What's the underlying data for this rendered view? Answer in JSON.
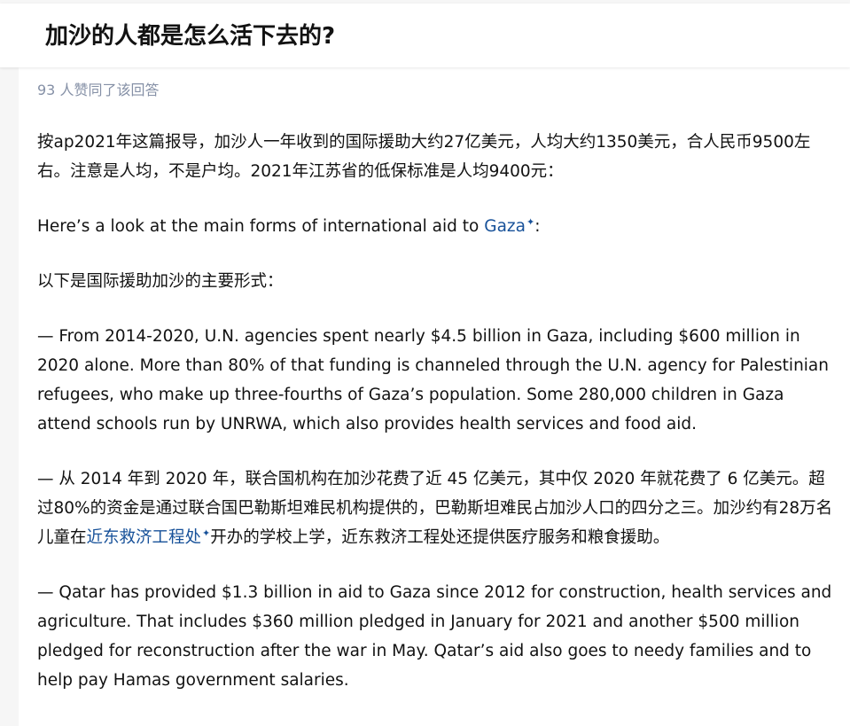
{
  "question": {
    "title": "加沙的人都是怎么活下去的?"
  },
  "answer": {
    "votes_label": "93 人赞同了该回答",
    "paragraphs": {
      "p1": "按ap2021年这篇报导，加沙人一年收到的国际援助大约27亿美元，人均大约1350美元，合人民币9500左右。注意是人均，不是户均。2021年江苏省的低保标准是人均9400元：",
      "p2_before": "Here’s a look at the main forms of international aid to ",
      "p2_link": "Gaza",
      "p2_after": ":",
      "p3": "以下是国际援助加沙的主要形式：",
      "p4": "— From 2014-2020, U.N. agencies spent nearly $4.5 billion in Gaza, including $600 million in 2020 alone. More than 80% of that funding is channeled through the U.N. agency for Palestinian refugees, who make up three-fourths of Gaza’s population. Some 280,000 children in Gaza attend schools run by UNRWA, which also provides health services and food aid.",
      "p5_before": "— 从 2014 年到 2020 年，联合国机构在加沙花费了近 45 亿美元，其中仅 2020 年就花费了 6 亿美元。超过80%的资金是通过联合国巴勒斯坦难民机构提供的，巴勒斯坦难民占加沙人口的四分之三。加沙约有28万名儿童在",
      "p5_link": "近东救济工程处",
      "p5_after": "开办的学校上学，近东救济工程处还提供医疗服务和粮食援助。",
      "p6": "— Qatar has provided $1.3 billion in aid to Gaza since 2012 for construction, health services and agriculture. That includes $360 million pledged in January for 2021 and another $500 million pledged for reconstruction after the war in May. Qatar’s aid also goes to needy families and to help pay Hamas government salaries."
    },
    "link_marker": "✦"
  },
  "colors": {
    "link": "#175199",
    "muted": "#8590a6",
    "text": "#121212"
  },
  "icons": {
    "link_marker": "sparkle-icon"
  }
}
